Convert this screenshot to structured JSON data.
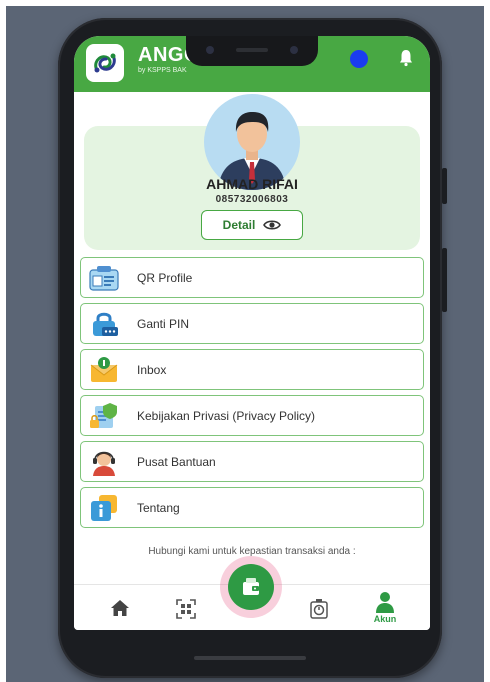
{
  "app": {
    "name": "ANGG",
    "subtitle": "by KSPPS BAK",
    "accent": "#48a843"
  },
  "profile": {
    "name": "AHMAD RIFAI",
    "phone": "085732006803",
    "detail_label": "Detail"
  },
  "menu": [
    {
      "label": "QR Profile",
      "icon": "id-card-icon"
    },
    {
      "label": "Ganti PIN",
      "icon": "lock-pin-icon"
    },
    {
      "label": "Inbox",
      "icon": "envelope-icon"
    },
    {
      "label": "Kebijakan Privasi (Privacy Policy)",
      "icon": "privacy-shield-icon"
    },
    {
      "label": "Pusat Bantuan",
      "icon": "support-agent-icon"
    },
    {
      "label": "Tentang",
      "icon": "info-icon"
    }
  ],
  "contact_note": "Hubungi kami untuk kepastian transaksi anda :",
  "bottom_nav": {
    "items": [
      "home-icon",
      "qr-scan-icon",
      "wallet-icon",
      "timer-icon",
      "account-icon"
    ],
    "active_label": "Akun"
  }
}
